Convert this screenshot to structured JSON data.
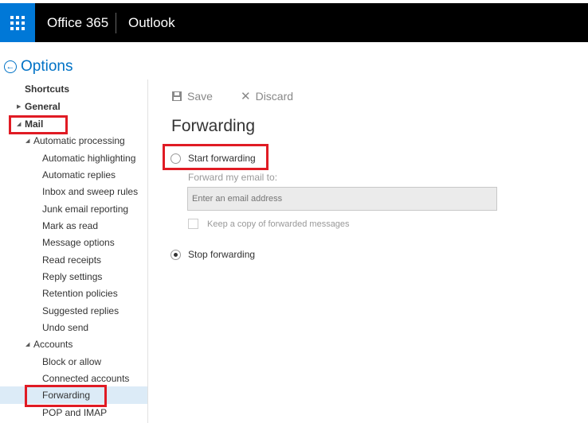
{
  "topbar": {
    "brand": "Office 365",
    "app_name": "Outlook",
    "waffle_icon": "app-launcher-icon"
  },
  "options_header": {
    "label": "Options",
    "icon": "back-arrow-icon"
  },
  "nav": {
    "shortcuts": "Shortcuts",
    "general": "General",
    "mail": "Mail",
    "automatic_processing": "Automatic processing",
    "items_auto": [
      "Automatic highlighting",
      "Automatic replies",
      "Inbox and sweep rules",
      "Junk email reporting",
      "Mark as read",
      "Message options",
      "Read receipts",
      "Reply settings",
      "Retention policies",
      "Suggested replies",
      "Undo send"
    ],
    "accounts": "Accounts",
    "items_accounts": [
      "Block or allow",
      "Connected accounts",
      "Forwarding",
      "POP and IMAP"
    ],
    "selected": "Forwarding"
  },
  "toolbar": {
    "save": "Save",
    "discard": "Discard"
  },
  "forwarding": {
    "title": "Forwarding",
    "start_option": "Start forwarding",
    "forward_to_label": "Forward my email to:",
    "email_placeholder": "Enter an email address",
    "keep_copy_label": "Keep a copy of forwarded messages",
    "stop_option": "Stop forwarding",
    "selected_option": "Stop forwarding"
  },
  "colors": {
    "topbar": "#000000",
    "waffle": "#0078d7",
    "accent": "#0072c6",
    "highlight_box": "#e01b24",
    "nav_selected": "#dcebf7"
  }
}
